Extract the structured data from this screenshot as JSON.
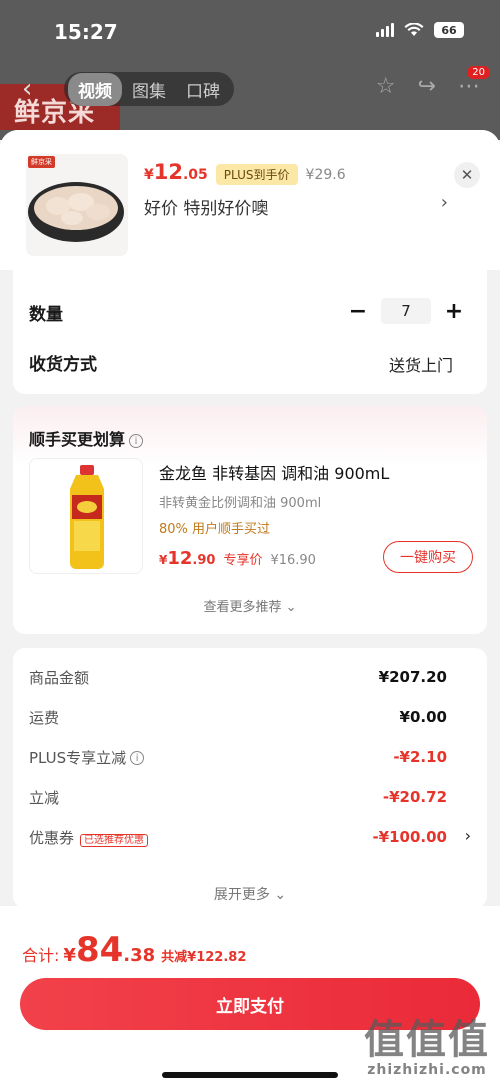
{
  "status_bar": {
    "time": "15:27",
    "battery": "66"
  },
  "background": {
    "brand_text": "鲜京采",
    "tabs": [
      {
        "label": "视频",
        "active": true
      },
      {
        "label": "图集",
        "active": false
      },
      {
        "label": "口碑",
        "active": false
      }
    ],
    "badge": "20"
  },
  "product": {
    "image_brand": "鲜京采",
    "price_currency": "¥",
    "price_int": "12",
    "price_dec": ".05",
    "plus_tag": "PLUS到手价",
    "original_price": "¥29.6",
    "description": "好价  特别好价噢"
  },
  "order": {
    "quantity_label": "数量",
    "quantity": "7",
    "minus": "−",
    "plus": "+",
    "delivery_label": "收货方式",
    "delivery_value": "送货上门"
  },
  "recommend": {
    "title": "顺手买更划算",
    "name": "金龙鱼 非转基因 调和油 900mL",
    "subtitle": "非转黄金比例调和油 900ml",
    "hint": "80% 用户顺手买过",
    "price_currency": "¥",
    "price_int": "12",
    "price_dec": ".90",
    "exclusive_label": "专享价",
    "original_price": "¥16.90",
    "buy_label": "一键购买",
    "more_label": "查看更多推荐 ⌄"
  },
  "summary": {
    "rows": [
      {
        "label": "商品金额",
        "value": "¥207.20"
      },
      {
        "label": "运费",
        "value": "¥0.00"
      },
      {
        "label": "PLUS专享立减",
        "value": "-¥2.10"
      },
      {
        "label": "立减",
        "value": "-¥20.72"
      },
      {
        "label": "优惠券",
        "value": "-¥100.00",
        "tag": "已选推荐优惠"
      }
    ],
    "expand_label": "展开更多 ⌄"
  },
  "footer": {
    "total_label": "合计:",
    "total_currency": "¥",
    "total_int": "84",
    "total_dec": ".38",
    "total_saved": "共减¥122.82",
    "pay_label": "立即支付"
  },
  "watermark": {
    "text": "值值值",
    "url": "zhizhizhi.com"
  },
  "colors": {
    "accent": "#e5352b",
    "plus_tag_bg": "#fbe7a6"
  }
}
